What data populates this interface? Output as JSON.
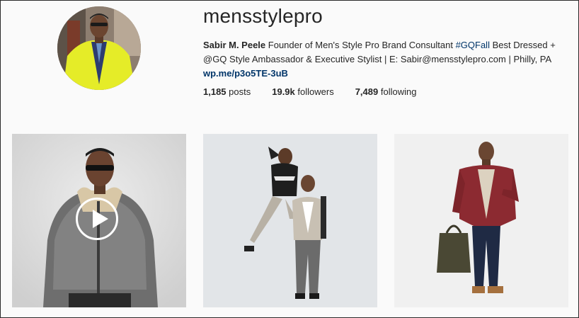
{
  "profile": {
    "username": "mensstylepro",
    "full_name": "Sabir M. Peele",
    "bio_text_1": " Founder of Men's Style Pro Brand Consultant ",
    "bio_tag": "#GQFall",
    "bio_text_2": " Best Dressed + @GQ Style Ambassador & Executive Stylist | E: Sabir@mensstylepro.com | Philly, PA",
    "link": "wp.me/p3o5TE-3uB"
  },
  "stats": {
    "posts_count": "1,185",
    "posts_label": " posts",
    "followers_count": "19.9k",
    "followers_label": " followers",
    "following_count": "7,489",
    "following_label": " following"
  },
  "colors": {
    "link": "#003569",
    "text": "#262626",
    "background": "#fafafa"
  },
  "icons": {
    "video": "play-icon"
  }
}
